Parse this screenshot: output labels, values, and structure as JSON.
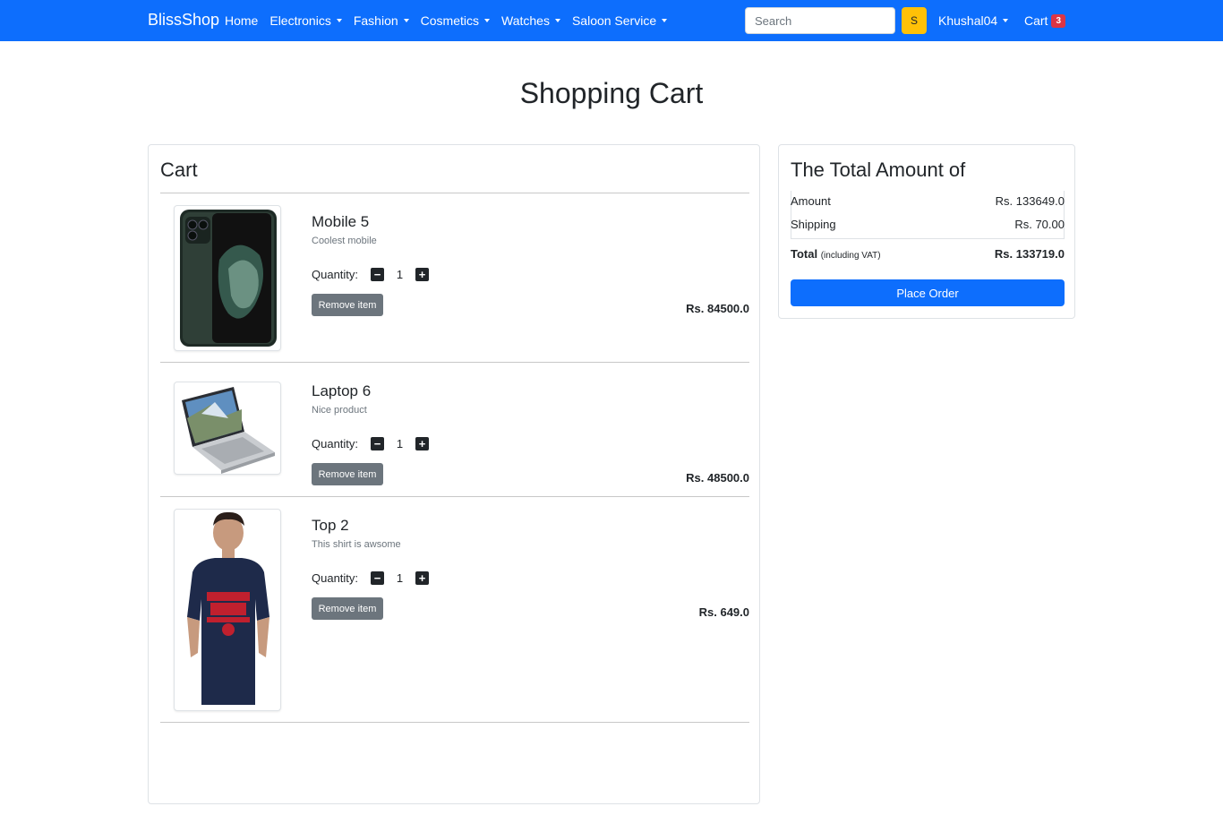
{
  "navbar": {
    "brand": "BlissShop",
    "links": [
      {
        "label": "Home",
        "dropdown": false
      },
      {
        "label": "Electronics",
        "dropdown": true
      },
      {
        "label": "Fashion",
        "dropdown": true
      },
      {
        "label": "Cosmetics",
        "dropdown": true
      },
      {
        "label": "Watches",
        "dropdown": true
      },
      {
        "label": "Saloon Service",
        "dropdown": true
      }
    ],
    "search": {
      "placeholder": "Search",
      "button_label": "S"
    },
    "user": "Khushal04",
    "cart_label": "Cart",
    "cart_count": "3",
    "colors": {
      "navbar": "#0d6efd",
      "search_button": "#ffc107",
      "badge": "#dc3545"
    }
  },
  "page_title": "Shopping Cart",
  "cart": {
    "heading": "Cart",
    "quantity_label": "Quantity:",
    "remove_label": "Remove item",
    "items": [
      {
        "name": "Mobile 5",
        "description": "Coolest mobile",
        "quantity": "1",
        "price": "Rs. 84500.0",
        "image_icon": "phone-image"
      },
      {
        "name": "Laptop 6",
        "description": "Nice product",
        "quantity": "1",
        "price": "Rs. 48500.0",
        "image_icon": "laptop-image"
      },
      {
        "name": "Top 2",
        "description": "This shirt is awsome",
        "quantity": "1",
        "price": "Rs. 649.0",
        "image_icon": "tshirt-image"
      }
    ]
  },
  "summary": {
    "title": "The Total Amount of",
    "amount_label": "Amount",
    "amount_value": "Rs. 133649.0",
    "shipping_label": "Shipping",
    "shipping_value": "Rs. 70.00",
    "total_label": "Total",
    "total_note": "(including VAT)",
    "total_value": "Rs. 133719.0",
    "place_order_label": "Place Order",
    "button_color": "#0d6efd"
  }
}
